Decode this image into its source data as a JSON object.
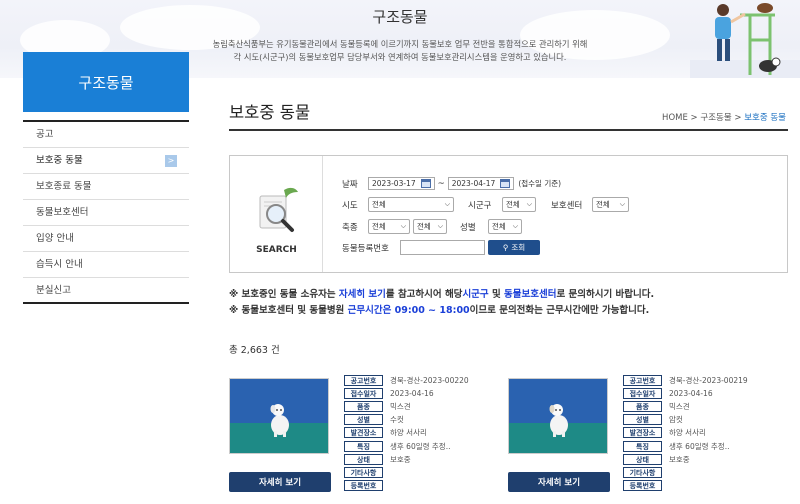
{
  "banner": {
    "title": "구조동물",
    "desc_line1": "농림축산식품부는 유기동물관리에서 동물등록에 이르기까지 동물보호 업무 전반을 통합적으로 관리하기 위해",
    "desc_line2": "각 시도(시군구)의 동물보호업무 담당부서와 연계하여 동물보호관리시스템을 운영하고 있습니다."
  },
  "sidebar": {
    "heading": "구조동물",
    "items": [
      {
        "label": "공고"
      },
      {
        "label": "보호중 동물"
      },
      {
        "label": "보호종료 동물"
      },
      {
        "label": "동물보호센터"
      },
      {
        "label": "입양 안내"
      },
      {
        "label": "습득시 안내"
      },
      {
        "label": "분실신고"
      }
    ]
  },
  "page": {
    "title": "보호중 동물",
    "breadcrumb": [
      "HOME",
      "구조동물",
      "보호중 동물"
    ],
    "breadcrumb_sep": ">"
  },
  "search": {
    "label": "SEARCH",
    "date_label": "날짜",
    "date_from": "2023-03-17",
    "date_to": "2023-04-17",
    "date_sep": "~",
    "date_note": "(접수일 기준)",
    "sido_label": "시도",
    "sido_value": "전체",
    "sigungu_label": "시군구",
    "sigungu_value": "전체",
    "center_label": "보호센터",
    "center_value": "전체",
    "kind_label": "축종",
    "kind_value1": "전체",
    "kind_value2": "전체",
    "sex_label": "성별",
    "sex_value": "전체",
    "regno_label": "동물등록번호",
    "regno_value": "",
    "button_label": "조회"
  },
  "notices": {
    "n1_a": "※ 보호중인 동물 소유자는 ",
    "n1_b": "자세히 보기",
    "n1_c": "를 참고하시어 해당",
    "n1_d": "시군구",
    "n1_e": " 및 ",
    "n1_f": "동물보호센터",
    "n1_g": "로 문의하시기 바랍니다.",
    "n2_a": "※ 동물보호센터 및 동물병원 ",
    "n2_b": "근무시간은 09:00 ~ 18:00",
    "n2_c": "이므로 문의전화는 근무시간에만 가능합니다."
  },
  "total": "총 2,663 건",
  "card_labels": [
    "공고번호",
    "접수일자",
    "품종",
    "성별",
    "발견장소",
    "특징",
    "상태",
    "기타사항",
    "등록번호"
  ],
  "cards": [
    {
      "values": [
        "경북-경산-2023-00220",
        "2023-04-16",
        "믹스견",
        "수컷",
        "하양 서사리",
        "생후 60일령 추정..",
        "보호중",
        "",
        ""
      ],
      "button": "자세히 보기"
    },
    {
      "values": [
        "경북-경산-2023-00219",
        "2023-04-16",
        "믹스견",
        "암컷",
        "하양 서사리",
        "생후 60일령 추정..",
        "보호중",
        "",
        ""
      ],
      "button": "자세히 보기"
    }
  ],
  "colors": {
    "accent": "#1a7fd6",
    "navy": "#1f3f6e",
    "emph": "#1a3fd8"
  }
}
